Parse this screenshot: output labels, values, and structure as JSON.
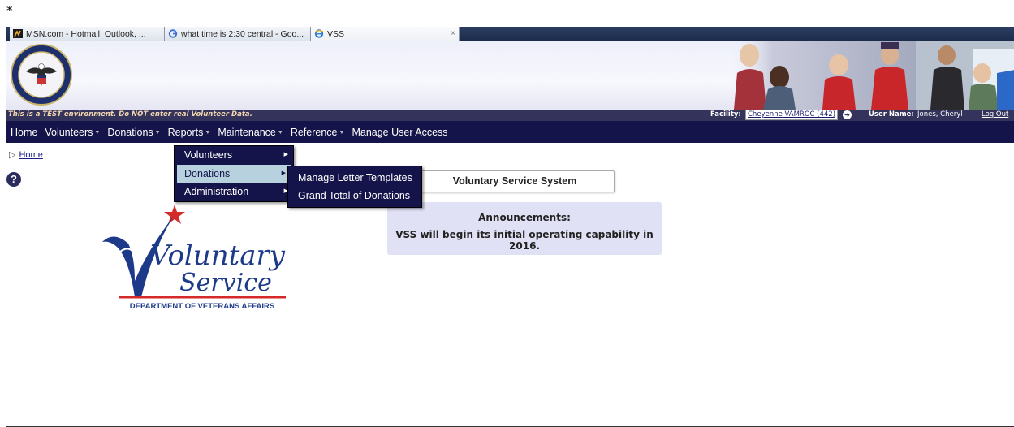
{
  "page_marker": "*",
  "browser_tabs": [
    {
      "label": "MSN.com - Hotmail, Outlook, ...",
      "icon": "msn-icon"
    },
    {
      "label": "what time is 2:30 central - Goo...",
      "icon": "google-icon"
    },
    {
      "label": "VSS",
      "icon": "ie-icon",
      "close": "×"
    }
  ],
  "status_bar": {
    "test_warning": "This is a TEST environment. Do NOT enter real Volunteer Data.",
    "facility_label": "Facility:",
    "facility_value": "Cheyenne VAMROC (442)",
    "user_label": "User Name:",
    "user_value": "Jones, Cheryl",
    "logout": "Log Out"
  },
  "nav": {
    "home": "Home",
    "volunteers": "Volunteers",
    "donations": "Donations",
    "reports": "Reports",
    "maintenance": "Maintenance",
    "reference": "Reference",
    "manage_user_access": "Manage User Access"
  },
  "reports_menu": {
    "items": [
      "Volunteers",
      "Donations",
      "Administration"
    ],
    "active": "Donations"
  },
  "donations_submenu": {
    "items": [
      "Manage Letter Templates",
      "Grand Total of Donations"
    ]
  },
  "breadcrumb": {
    "home": "Home"
  },
  "main": {
    "system_title": "Voluntary Service System",
    "announcements_heading": "Announcements:",
    "announcements_body": "VSS will begin its initial operating capability in 2016."
  },
  "logo": {
    "line1": "Voluntary",
    "line2": "Service",
    "line3": "DEPARTMENT OF VETERANS AFFAIRS"
  },
  "colors": {
    "nav_bg": "#14144a",
    "strip_bg": "#33335c",
    "menu_highlight": "#b7d2de",
    "announce_bg": "#e1e1f6",
    "logo_blue": "#1d3a8a",
    "logo_red": "#d42a2a"
  }
}
